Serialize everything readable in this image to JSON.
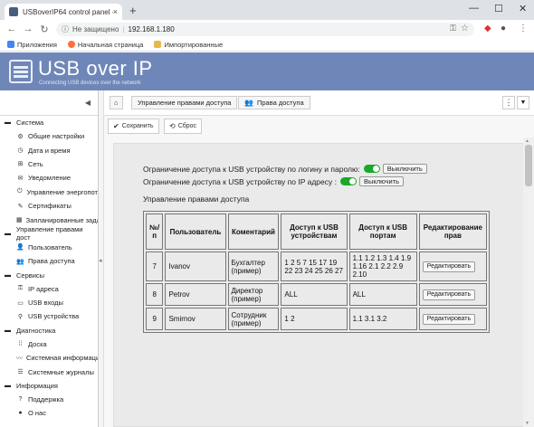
{
  "browser": {
    "tab_title": "USBoverIP64 control panel - USB",
    "tab_close": "×",
    "new_tab": "+",
    "security": "Не защищено",
    "url": "192.168.1.180",
    "bookmarks": [
      "Приложения",
      "Начальная страница",
      "Импортированные"
    ],
    "win_min": "—",
    "win_max": "☐",
    "win_close": "✕"
  },
  "header": {
    "title": "USB over IP",
    "subtitle": "Connecting USB devices over the network"
  },
  "sidebar": {
    "sections": [
      {
        "label": "Система",
        "items": [
          "Общие настройки",
          "Дата и время",
          "Сеть",
          "Уведомление",
          "Управление энергопот",
          "Сертификаты",
          "Запланированные зада"
        ]
      },
      {
        "label": "Управление правами дост",
        "items": [
          "Пользователь",
          "Права доступа"
        ]
      },
      {
        "label": "Сервисы",
        "items": [
          "IP адреса",
          "USB входы",
          "USB устройства"
        ]
      },
      {
        "label": "Диагностика",
        "items": [
          "Доска",
          "Системная информаци",
          "Системные журналы"
        ]
      },
      {
        "label": "Информация",
        "items": [
          "Поддержка",
          "О нас"
        ]
      }
    ]
  },
  "breadcrumb": {
    "item1": "Управление правами доступа",
    "item2": "Права доступа"
  },
  "toolbar": {
    "save": "Сохранить",
    "reset": "Сброс"
  },
  "settings": {
    "login_restriction": "Ограничение доступа к USB устройству по логину и паролю:",
    "ip_restriction": "Ограничение доступа к USB устройству по IP адресу :",
    "disable_label": "Выключить",
    "section_title": "Управление правами доступа"
  },
  "table": {
    "headers": [
      "№/п",
      "Пользователь",
      "Коментарий",
      "Доступ к USB устройствам",
      "Доступ к USB портам",
      "Редактирование прав"
    ],
    "edit_label": "Редактировать",
    "rows": [
      {
        "num": "7",
        "user": "Ivanov",
        "comment": "Бухгалтер (пример)",
        "devices": "1 2 5 7 15 17 19 22 23 24 25 26 27",
        "ports": "1.1 1.2 1.3 1.4 1.9 1.16 2.1 2.2 2.9 2.10"
      },
      {
        "num": "8",
        "user": "Petrov",
        "comment": "Директор (пример)",
        "devices": "ALL",
        "ports": "ALL"
      },
      {
        "num": "9",
        "user": "Smirnov",
        "comment": "Сотрудник (пример)",
        "devices": "1 2",
        "ports": "1.1 3.1 3.2"
      }
    ]
  },
  "colors": {
    "header_bg": "#6f87b8",
    "toggle_on": "#1aa72a"
  }
}
